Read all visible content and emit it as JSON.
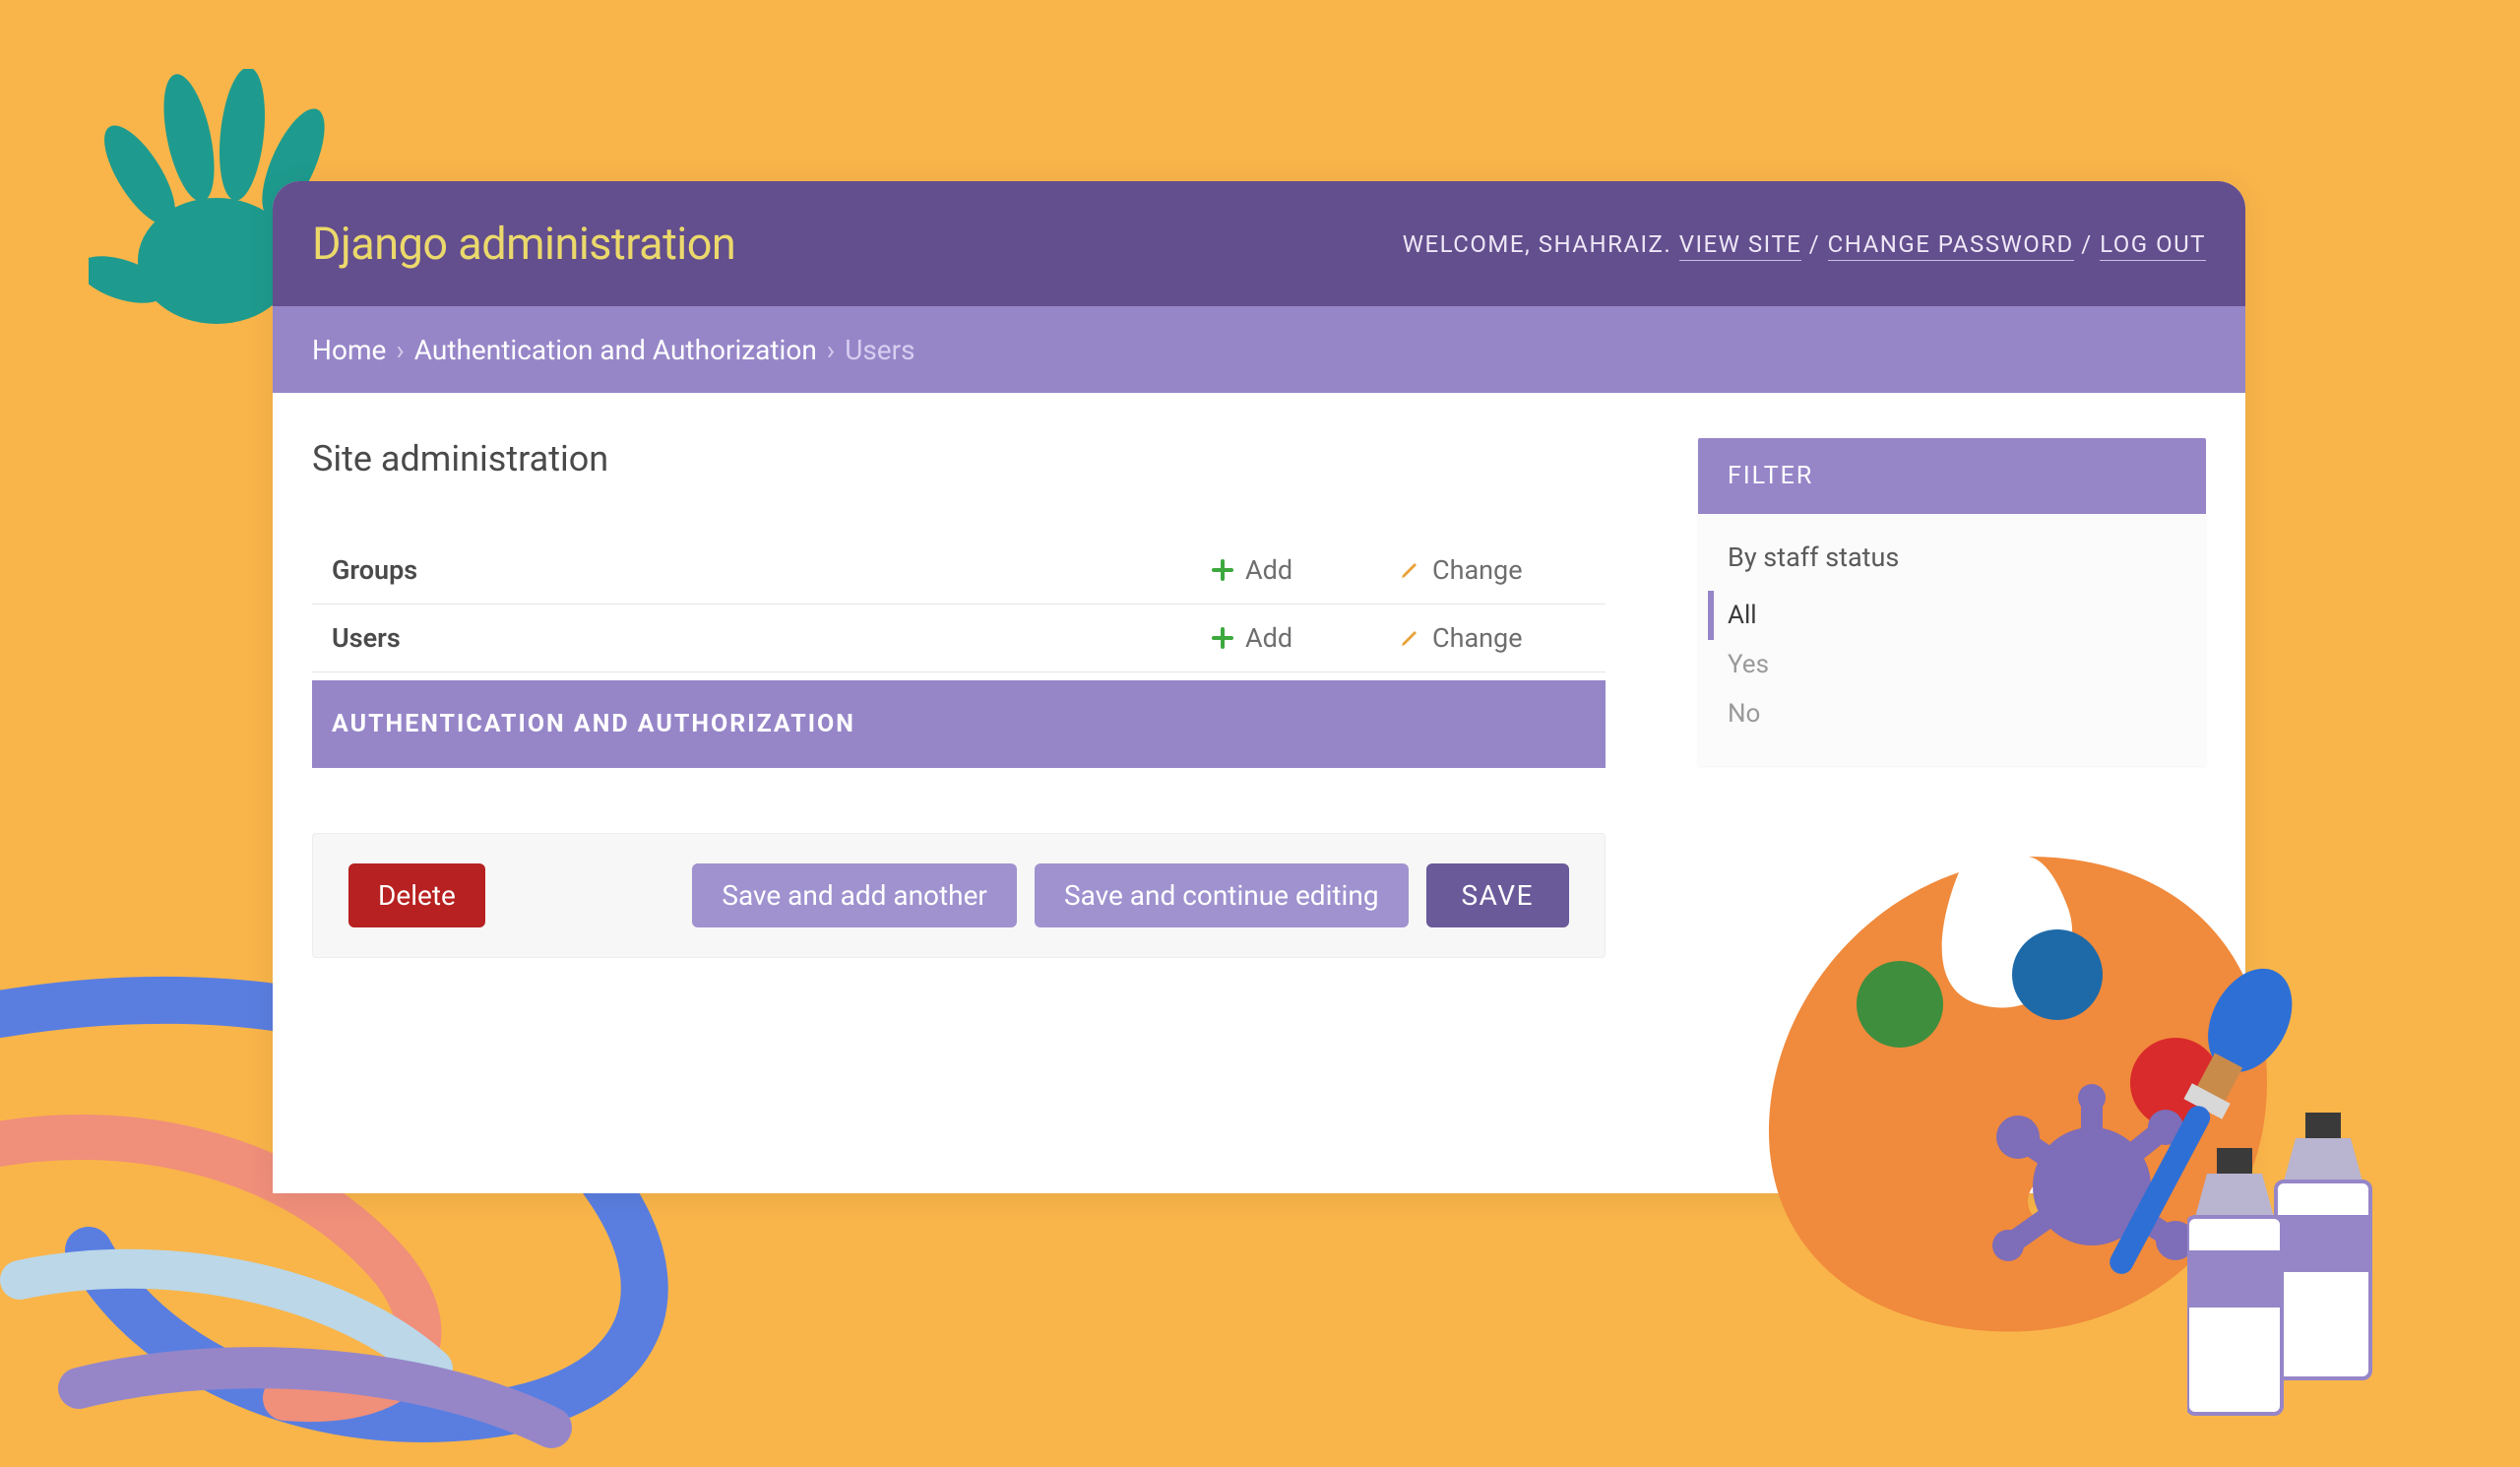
{
  "header": {
    "brand": "Django administration",
    "welcome_prefix": "WELCOME, ",
    "username": "SHAHRAIZ",
    "view_site": "VIEW SITE",
    "change_password": "CHANGE PASSWORD",
    "log_out": "LOG OUT"
  },
  "breadcrumb": {
    "home": "Home",
    "section": "Authentication and Authorization",
    "current": "Users"
  },
  "page_title": "Site administration",
  "models": [
    {
      "name": "Groups",
      "add": "Add",
      "change": "Change"
    },
    {
      "name": "Users",
      "add": "Add",
      "change": "Change"
    }
  ],
  "section_header": "AUTHENTICATION AND AUTHORIZATION",
  "buttons": {
    "delete": "Delete",
    "save_add_another": "Save and add another",
    "save_continue": "Save and continue editing",
    "save": "SAVE"
  },
  "filter": {
    "header": "FILTER",
    "title": "By staff status",
    "options": [
      {
        "label": "All",
        "selected": true
      },
      {
        "label": "Yes",
        "selected": false
      },
      {
        "label": "No",
        "selected": false
      }
    ]
  },
  "colors": {
    "bg": "#F9B54A",
    "header_dark": "#634E8E",
    "header_light": "#9686C8",
    "accent_yellow": "#EBD96B",
    "delete_red": "#B72121"
  }
}
